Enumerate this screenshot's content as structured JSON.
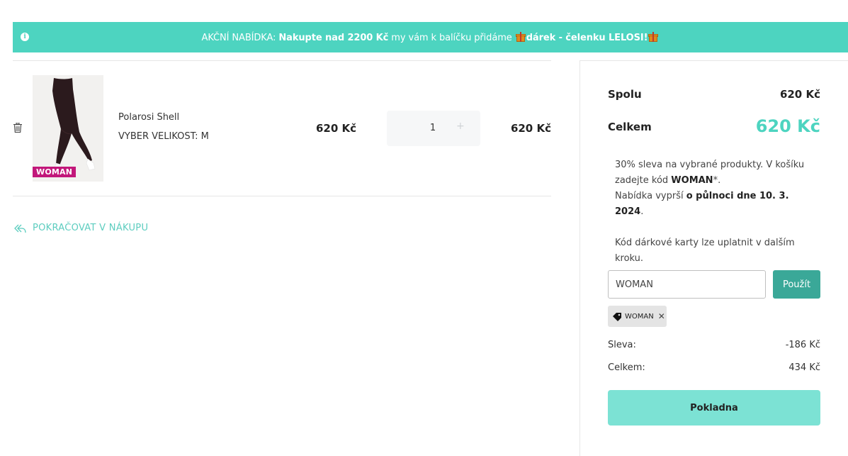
{
  "banner": {
    "prefix": "AKČNÍ NABÍDKA: ",
    "bold1": "Nakupte nad 2200 Kč",
    "middle": " my vám k balíčku přidáme ",
    "bold2": "dárek - čelenku LELOSI!",
    "icons": [
      "info-icon",
      "gift-icon",
      "gift-icon"
    ]
  },
  "cart": {
    "items": [
      {
        "name": "Polarosi Shell",
        "size": "VYBER VELIKOST: M",
        "badge": "WOMAN",
        "unit_price": "620 Kč",
        "quantity": "1",
        "total": "620 Kč"
      }
    ],
    "continue_label": "POKRAČOVAT V NÁKUPU"
  },
  "summary": {
    "subtotal_label": "Spolu",
    "subtotal_value": "620 Kč",
    "total_label": "Celkem",
    "total_value": "620 Kč",
    "promo_line1": "30% sleva na vybrané produkty. V košíku zadejte kód ",
    "promo_code": "WOMAN",
    "promo_line1_end": "*.",
    "promo_line2": "Nabídka vyprší ",
    "promo_deadline": "o půlnoci dne 10. 3. 2024",
    "promo_line2_end": ".",
    "gift_card_note": "Kód dárkové karty lze uplatnit v dalším kroku.",
    "code_input_value": "WOMAN",
    "apply_label": "Použít",
    "applied_coupon": "WOMAN",
    "discount_label": "Sleva:",
    "discount_value": "-186 Kč",
    "final_label": "Celkem:",
    "final_value": "434 Kč",
    "checkout_label": "Pokladna"
  },
  "colors": {
    "accent": "#4dd4c0",
    "apply_button": "#3aa898",
    "checkout_button": "#7ce2d4",
    "badge": "#c2177a"
  }
}
